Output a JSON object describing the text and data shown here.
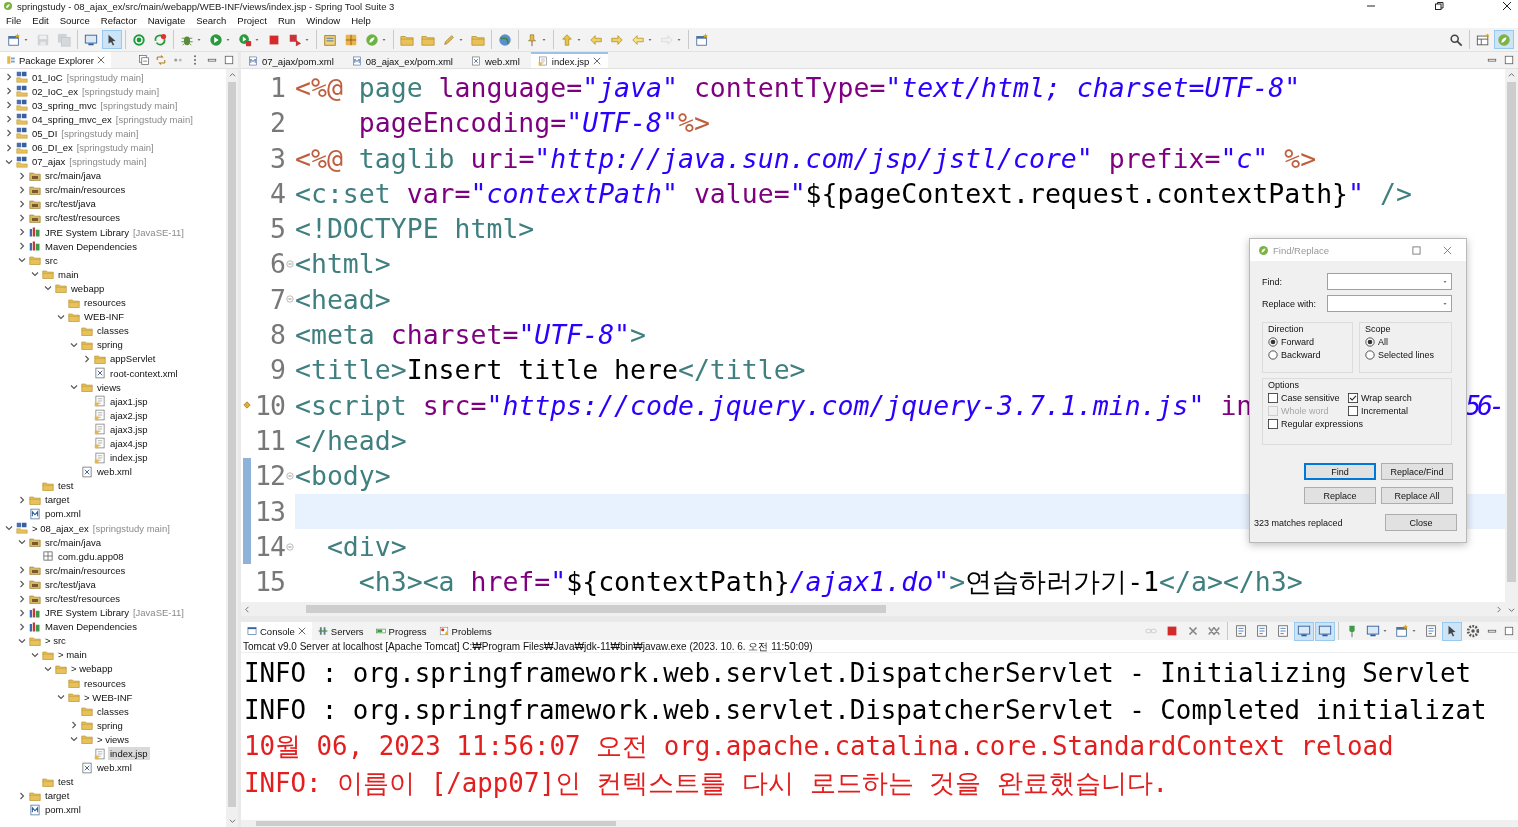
{
  "window": {
    "title": "springstudy - 08_ajax_ex/src/main/webapp/WEB-INF/views/index.jsp - Spring Tool Suite 3"
  },
  "menu": [
    "File",
    "Edit",
    "Source",
    "Refactor",
    "Navigate",
    "Search",
    "Project",
    "Run",
    "Window",
    "Help"
  ],
  "toolbar": [
    [
      {
        "kind": "new",
        "dropdown": true,
        "pressed": false,
        "disabled": false
      },
      {
        "kind": "save",
        "dropdown": false,
        "pressed": false,
        "disabled": true
      },
      {
        "kind": "save-all",
        "dropdown": false,
        "pressed": false,
        "disabled": true
      }
    ],
    [
      {
        "kind": "monitor",
        "dropdown": false,
        "pressed": false,
        "disabled": false
      },
      {
        "kind": "pointer",
        "dropdown": false,
        "pressed": true,
        "disabled": false
      }
    ],
    [
      {
        "kind": "power",
        "dropdown": false,
        "pressed": false,
        "disabled": false
      },
      {
        "kind": "refresh",
        "dropdown": false,
        "pressed": false,
        "disabled": false
      }
    ],
    [
      {
        "kind": "bug",
        "dropdown": true,
        "pressed": false,
        "disabled": false
      },
      {
        "kind": "run",
        "dropdown": true,
        "pressed": false,
        "disabled": false
      },
      {
        "kind": "coverage",
        "dropdown": true,
        "pressed": false,
        "disabled": false
      },
      {
        "kind": "stop",
        "dropdown": false,
        "pressed": false,
        "disabled": false
      },
      {
        "kind": "deploy",
        "dropdown": true,
        "pressed": false,
        "disabled": false
      }
    ],
    [
      {
        "kind": "jar",
        "dropdown": false,
        "pressed": false,
        "disabled": false
      },
      {
        "kind": "puzzle",
        "dropdown": false,
        "pressed": false,
        "disabled": false
      },
      {
        "kind": "spring-run",
        "dropdown": true,
        "pressed": false,
        "disabled": false
      }
    ],
    [
      {
        "kind": "folder",
        "dropdown": false,
        "pressed": false,
        "disabled": false
      },
      {
        "kind": "folder",
        "dropdown": false,
        "pressed": false,
        "disabled": false
      },
      {
        "kind": "pen",
        "dropdown": true,
        "pressed": false,
        "disabled": false
      },
      {
        "kind": "folder",
        "dropdown": false,
        "pressed": false,
        "disabled": false
      }
    ],
    [
      {
        "kind": "globe",
        "dropdown": false,
        "pressed": false,
        "disabled": false
      }
    ],
    [
      {
        "kind": "annotation",
        "dropdown": true,
        "pressed": false,
        "disabled": false
      }
    ],
    [
      {
        "kind": "up",
        "dropdown": true,
        "pressed": false,
        "disabled": false
      },
      {
        "kind": "edit-back",
        "dropdown": false,
        "pressed": false,
        "disabled": false
      },
      {
        "kind": "edit-fwd",
        "dropdown": false,
        "pressed": false,
        "disabled": false
      },
      {
        "kind": "back",
        "dropdown": true,
        "pressed": false,
        "disabled": false
      },
      {
        "kind": "forward",
        "dropdown": true,
        "pressed": false,
        "disabled": true
      }
    ],
    [
      {
        "kind": "new",
        "dropdown": false,
        "pressed": false,
        "disabled": false
      }
    ]
  ],
  "toolbar_right": [
    [
      {
        "kind": "search",
        "dropdown": false,
        "pressed": false,
        "disabled": false
      }
    ],
    [
      {
        "kind": "open-perspective",
        "dropdown": false,
        "pressed": false,
        "disabled": false
      },
      {
        "kind": "spring",
        "dropdown": false,
        "pressed": true,
        "disabled": false
      }
    ]
  ],
  "explorer": {
    "tab": "Package Explorer",
    "tree": [
      {
        "label": "01_IoC",
        "detail": "[springstudy main]",
        "kind": "project",
        "expanded": false,
        "selected": false
      },
      {
        "label": "02_IoC_ex",
        "detail": "[springstudy main]",
        "kind": "project",
        "expanded": false,
        "selected": false
      },
      {
        "label": "03_spring_mvc",
        "detail": "[springstudy main]",
        "kind": "project",
        "expanded": false,
        "selected": false
      },
      {
        "label": "04_spring_mvc_ex",
        "detail": "[springstudy main]",
        "kind": "project",
        "expanded": false,
        "selected": false
      },
      {
        "label": "05_DI",
        "detail": "[springstudy main]",
        "kind": "project",
        "expanded": false,
        "selected": false
      },
      {
        "label": "06_DI_ex",
        "detail": "[springstudy main]",
        "kind": "project",
        "expanded": false,
        "selected": false
      },
      {
        "label": "07_ajax",
        "detail": "[springstudy main]",
        "kind": "project",
        "expanded": true,
        "selected": false,
        "children": [
          {
            "label": "src/main/java",
            "kind": "srcfolder",
            "expanded": false,
            "selected": false
          },
          {
            "label": "src/main/resources",
            "kind": "srcfolder",
            "expanded": false,
            "selected": false
          },
          {
            "label": "src/test/java",
            "kind": "srcfolder",
            "expanded": false,
            "selected": false
          },
          {
            "label": "src/test/resources",
            "kind": "srcfolder",
            "expanded": false,
            "selected": false
          },
          {
            "label": "JRE System Library",
            "detail": "[JavaSE-11]",
            "kind": "library",
            "expanded": false,
            "selected": false
          },
          {
            "label": "Maven Dependencies",
            "kind": "library",
            "expanded": false,
            "selected": false
          },
          {
            "label": "src",
            "kind": "folder",
            "expanded": true,
            "selected": false,
            "children": [
              {
                "label": "main",
                "kind": "folder",
                "expanded": true,
                "selected": false,
                "children": [
                  {
                    "label": "webapp",
                    "kind": "folder",
                    "expanded": true,
                    "selected": false,
                    "children": [
                      {
                        "label": "resources",
                        "kind": "folder",
                        "selected": false
                      },
                      {
                        "label": "WEB-INF",
                        "kind": "folder",
                        "expanded": true,
                        "selected": false,
                        "children": [
                          {
                            "label": "classes",
                            "kind": "folder",
                            "selected": false
                          },
                          {
                            "label": "spring",
                            "kind": "folder",
                            "expanded": true,
                            "selected": false,
                            "children": [
                              {
                                "label": "appServlet",
                                "kind": "folder",
                                "expanded": false,
                                "selected": false
                              },
                              {
                                "label": "root-context.xml",
                                "kind": "xml",
                                "selected": false
                              }
                            ]
                          },
                          {
                            "label": "views",
                            "kind": "folder",
                            "expanded": true,
                            "selected": false,
                            "children": [
                              {
                                "label": "ajax1.jsp",
                                "kind": "jsp",
                                "selected": false
                              },
                              {
                                "label": "ajax2.jsp",
                                "kind": "jsp",
                                "selected": false
                              },
                              {
                                "label": "ajax3.jsp",
                                "kind": "jsp",
                                "selected": false
                              },
                              {
                                "label": "ajax4.jsp",
                                "kind": "jsp",
                                "selected": false
                              },
                              {
                                "label": "index.jsp",
                                "kind": "jsp",
                                "selected": false
                              }
                            ]
                          },
                          {
                            "label": "web.xml",
                            "kind": "xml",
                            "selected": false
                          }
                        ]
                      }
                    ]
                  }
                ]
              },
              {
                "label": "test",
                "kind": "folder",
                "selected": false
              }
            ]
          },
          {
            "label": "target",
            "kind": "folder",
            "expanded": false,
            "selected": false
          },
          {
            "label": "pom.xml",
            "kind": "pom",
            "selected": false
          }
        ]
      },
      {
        "label": "> 08_ajax_ex",
        "detail": "[springstudy main]",
        "kind": "project",
        "expanded": true,
        "selected": false,
        "children": [
          {
            "label": "src/main/java",
            "kind": "srcfolder",
            "expanded": true,
            "selected": false,
            "children": [
              {
                "label": "com.gdu.app08",
                "kind": "package",
                "selected": false
              }
            ]
          },
          {
            "label": "src/main/resources",
            "kind": "srcfolder",
            "expanded": false,
            "selected": false
          },
          {
            "label": "src/test/java",
            "kind": "srcfolder",
            "expanded": false,
            "selected": false
          },
          {
            "label": "src/test/resources",
            "kind": "srcfolder",
            "expanded": false,
            "selected": false
          },
          {
            "label": "JRE System Library",
            "detail": "[JavaSE-11]",
            "kind": "library",
            "expanded": false,
            "selected": false
          },
          {
            "label": "Maven Dependencies",
            "kind": "library",
            "expanded": false,
            "selected": false
          },
          {
            "label": "> src",
            "kind": "folder",
            "expanded": true,
            "selected": false,
            "children": [
              {
                "label": "> main",
                "kind": "folder",
                "expanded": true,
                "selected": false,
                "children": [
                  {
                    "label": "> webapp",
                    "kind": "folder",
                    "expanded": true,
                    "selected": false,
                    "children": [
                      {
                        "label": "resources",
                        "kind": "folder",
                        "selected": false
                      },
                      {
                        "label": "> WEB-INF",
                        "kind": "folder",
                        "expanded": true,
                        "selected": false,
                        "children": [
                          {
                            "label": "classes",
                            "kind": "folder",
                            "selected": false
                          },
                          {
                            "label": "spring",
                            "kind": "folder",
                            "expanded": false,
                            "selected": false
                          },
                          {
                            "label": "> views",
                            "kind": "folder",
                            "expanded": true,
                            "selected": false,
                            "children": [
                              {
                                "label": "index.jsp",
                                "kind": "jsp",
                                "selected": true
                              }
                            ]
                          },
                          {
                            "label": "web.xml",
                            "kind": "xml",
                            "selected": false
                          }
                        ]
                      }
                    ]
                  }
                ]
              },
              {
                "label": "test",
                "kind": "folder",
                "selected": false
              }
            ]
          },
          {
            "label": "target",
            "kind": "folder",
            "expanded": false,
            "selected": false
          },
          {
            "label": "pom.xml",
            "kind": "pom",
            "selected": false
          }
        ]
      }
    ]
  },
  "editor": {
    "tabs": [
      {
        "label": "07_ajax/pom.xml",
        "kind": "pom",
        "selected": false
      },
      {
        "label": "08_ajax_ex/pom.xml",
        "kind": "pom",
        "selected": false
      },
      {
        "label": "web.xml",
        "kind": "xml",
        "selected": false
      },
      {
        "label": "index.jsp",
        "kind": "jsp",
        "selected": true
      }
    ],
    "lines": [
      {
        "number": "1",
        "fold": false,
        "changed": false,
        "current": false,
        "annotation": false,
        "segments": [
          {
            "kind": "delim",
            "text": "<%@"
          },
          {
            "kind": "directive",
            "text": " page"
          },
          {
            "kind": "attr",
            "text": " language="
          },
          {
            "kind": "value",
            "text": "\"java\""
          },
          {
            "kind": "attr",
            "text": " contentType="
          },
          {
            "kind": "value",
            "text": "\"text/html; charset=UTF-8\""
          }
        ]
      },
      {
        "number": "2",
        "fold": false,
        "changed": false,
        "current": false,
        "annotation": false,
        "segments": [
          {
            "kind": "attr",
            "text": "    pageEncoding="
          },
          {
            "kind": "value",
            "text": "\"UTF-8\""
          },
          {
            "kind": "delim",
            "text": "%>"
          }
        ]
      },
      {
        "number": "3",
        "fold": false,
        "changed": false,
        "current": false,
        "annotation": false,
        "segments": [
          {
            "kind": "delim",
            "text": "<%@"
          },
          {
            "kind": "directive",
            "text": " taglib"
          },
          {
            "kind": "attr",
            "text": " uri="
          },
          {
            "kind": "value",
            "text": "\"http://java.sun.com/jsp/jstl/core\""
          },
          {
            "kind": "attr",
            "text": " prefix="
          },
          {
            "kind": "value",
            "text": "\"c\""
          },
          {
            "kind": "delim",
            "text": " %>"
          }
        ]
      },
      {
        "number": "4",
        "fold": false,
        "changed": false,
        "current": false,
        "annotation": false,
        "segments": [
          {
            "kind": "tag",
            "text": "<c:set"
          },
          {
            "kind": "attr",
            "text": " var="
          },
          {
            "kind": "value",
            "text": "\"contextPath\""
          },
          {
            "kind": "attr",
            "text": " value="
          },
          {
            "kind": "value",
            "text": "\""
          },
          {
            "kind": "plain",
            "text": "${pageContext.request.contextPath}"
          },
          {
            "kind": "value",
            "text": "\""
          },
          {
            "kind": "tag",
            "text": " />"
          }
        ]
      },
      {
        "number": "5",
        "fold": false,
        "changed": false,
        "current": false,
        "annotation": false,
        "segments": [
          {
            "kind": "tag",
            "text": "<!DOCTYPE html>"
          }
        ]
      },
      {
        "number": "6",
        "fold": true,
        "changed": false,
        "current": false,
        "annotation": false,
        "segments": [
          {
            "kind": "tag",
            "text": "<html>"
          }
        ]
      },
      {
        "number": "7",
        "fold": true,
        "changed": false,
        "current": false,
        "annotation": false,
        "segments": [
          {
            "kind": "tag",
            "text": "<head>"
          }
        ]
      },
      {
        "number": "8",
        "fold": false,
        "changed": false,
        "current": false,
        "annotation": false,
        "segments": [
          {
            "kind": "tag",
            "text": "<meta"
          },
          {
            "kind": "attr",
            "text": " charset="
          },
          {
            "kind": "value",
            "text": "\"UTF-8\""
          },
          {
            "kind": "tag",
            "text": ">"
          }
        ]
      },
      {
        "number": "9",
        "fold": false,
        "changed": false,
        "current": false,
        "annotation": false,
        "segments": [
          {
            "kind": "tag",
            "text": "<title>"
          },
          {
            "kind": "plain",
            "text": "Insert title here"
          },
          {
            "kind": "tag",
            "text": "</title>"
          }
        ]
      },
      {
        "number": "10",
        "fold": false,
        "changed": false,
        "current": false,
        "annotation": true,
        "segments": [
          {
            "kind": "tag",
            "text": "<script"
          },
          {
            "kind": "attr",
            "text": " src="
          },
          {
            "kind": "value",
            "text": "\"https://code.jquery.com/jquery-3.7.1.min.js\""
          },
          {
            "kind": "attr",
            "text": " in"
          }
        ],
        "tail": "56-"
      },
      {
        "number": "11",
        "fold": false,
        "changed": false,
        "current": false,
        "annotation": false,
        "segments": [
          {
            "kind": "tag",
            "text": "</head>"
          }
        ]
      },
      {
        "number": "12",
        "fold": true,
        "changed": true,
        "current": false,
        "annotation": false,
        "segments": [
          {
            "kind": "tag",
            "text": "<body>"
          }
        ]
      },
      {
        "number": "13",
        "fold": false,
        "changed": true,
        "current": true,
        "annotation": false
      },
      {
        "number": "14",
        "fold": true,
        "changed": true,
        "current": false,
        "annotation": false,
        "segments": [
          {
            "kind": "tag",
            "text": "  <div>"
          }
        ]
      },
      {
        "number": "15",
        "fold": false,
        "changed": false,
        "current": false,
        "annotation": false,
        "segments": [
          {
            "kind": "tag",
            "text": "    <h3><a"
          },
          {
            "kind": "attr",
            "text": " href="
          },
          {
            "kind": "value",
            "text": "\""
          },
          {
            "kind": "plain",
            "text": "${contextPath}"
          },
          {
            "kind": "value",
            "text": "/ajax1.do\""
          },
          {
            "kind": "tag",
            "text": ">"
          },
          {
            "kind": "plain",
            "text": "연습하러가기-1"
          },
          {
            "kind": "tag",
            "text": "</a></h3>"
          }
        ]
      }
    ]
  },
  "find_replace": {
    "title": "Find/Replace",
    "find_label": "Find:",
    "replace_label": "Replace with:",
    "direction": {
      "title": "Direction",
      "options": [
        {
          "label": "Forward",
          "selected": true
        },
        {
          "label": "Backward",
          "selected": false
        }
      ]
    },
    "scope": {
      "title": "Scope",
      "options": [
        {
          "label": "All",
          "selected": true
        },
        {
          "label": "Selected lines",
          "selected": false
        }
      ]
    },
    "options": {
      "title": "Options",
      "items": [
        {
          "label": "Case sensitive",
          "checked": false,
          "disabled": false
        },
        {
          "label": "Wrap search",
          "checked": true,
          "disabled": false
        },
        {
          "label": "Whole word",
          "checked": false,
          "disabled": true
        },
        {
          "label": "Incremental",
          "checked": false,
          "disabled": false
        },
        {
          "label": "Regular expressions",
          "checked": false,
          "disabled": false
        }
      ]
    },
    "buttons": [
      {
        "label": "Find",
        "default": true
      },
      {
        "label": "Replace/Find",
        "default": false
      },
      {
        "label": "Replace",
        "default": false
      },
      {
        "label": "Replace All",
        "default": false
      }
    ],
    "status": "323 matches replaced",
    "close": "Close"
  },
  "console": {
    "tabs": [
      {
        "label": "Console",
        "kind": "console",
        "selected": true
      },
      {
        "label": "Servers",
        "kind": "servers",
        "selected": false
      },
      {
        "label": "Progress",
        "kind": "progress",
        "selected": false
      },
      {
        "label": "Problems",
        "kind": "problems",
        "selected": false
      }
    ],
    "tools": [
      [
        {
          "kind": "link",
          "dropdown": false,
          "pressed": false,
          "disabled": true
        },
        {
          "kind": "stop",
          "dropdown": false,
          "pressed": false,
          "disabled": false
        },
        {
          "kind": "remove",
          "dropdown": false,
          "pressed": false,
          "disabled": false
        },
        {
          "kind": "remove-all",
          "dropdown": false,
          "pressed": false,
          "disabled": false
        }
      ],
      [
        {
          "kind": "doc",
          "dropdown": false,
          "pressed": false,
          "disabled": false
        },
        {
          "kind": "doc",
          "dropdown": false,
          "pressed": false,
          "disabled": false
        },
        {
          "kind": "doc",
          "dropdown": false,
          "pressed": false,
          "disabled": false
        },
        {
          "kind": "monitor",
          "dropdown": false,
          "pressed": true,
          "disabled": false
        },
        {
          "kind": "monitor",
          "dropdown": false,
          "pressed": true,
          "disabled": false
        }
      ],
      [
        {
          "kind": "pin",
          "dropdown": false,
          "pressed": false,
          "disabled": false
        },
        {
          "kind": "monitor",
          "dropdown": true,
          "pressed": false,
          "disabled": false
        },
        {
          "kind": "new",
          "dropdown": true,
          "pressed": false,
          "disabled": false
        },
        {
          "kind": "doc",
          "dropdown": false,
          "pressed": false,
          "disabled": false
        },
        {
          "kind": "pointer",
          "dropdown": false,
          "pressed": true,
          "disabled": false
        },
        {
          "kind": "gear",
          "dropdown": false,
          "pressed": false,
          "disabled": false
        }
      ]
    ],
    "process": "Tomcat v9.0 Server at localhost [Apache Tomcat] C:₩Program Files₩Java₩jdk-11₩bin₩javaw.exe  (2023. 10. 6. 오전 11:50:09)",
    "lines": [
      {
        "text": "INFO : org.springframework.web.servlet.DispatcherServlet - Initializing Servlet",
        "error": false
      },
      {
        "text": "INFO : org.springframework.web.servlet.DispatcherServlet - Completed initializat",
        "error": false
      },
      {
        "text": "10월 06, 2023 11:56:07 오전 org.apache.catalina.core.StandardContext reload",
        "error": true
      },
      {
        "text": "INFO: 이름이 [/app07]인 컨텍스트를 다시 로드하는 것을 완료했습니다.",
        "error": true
      }
    ]
  }
}
